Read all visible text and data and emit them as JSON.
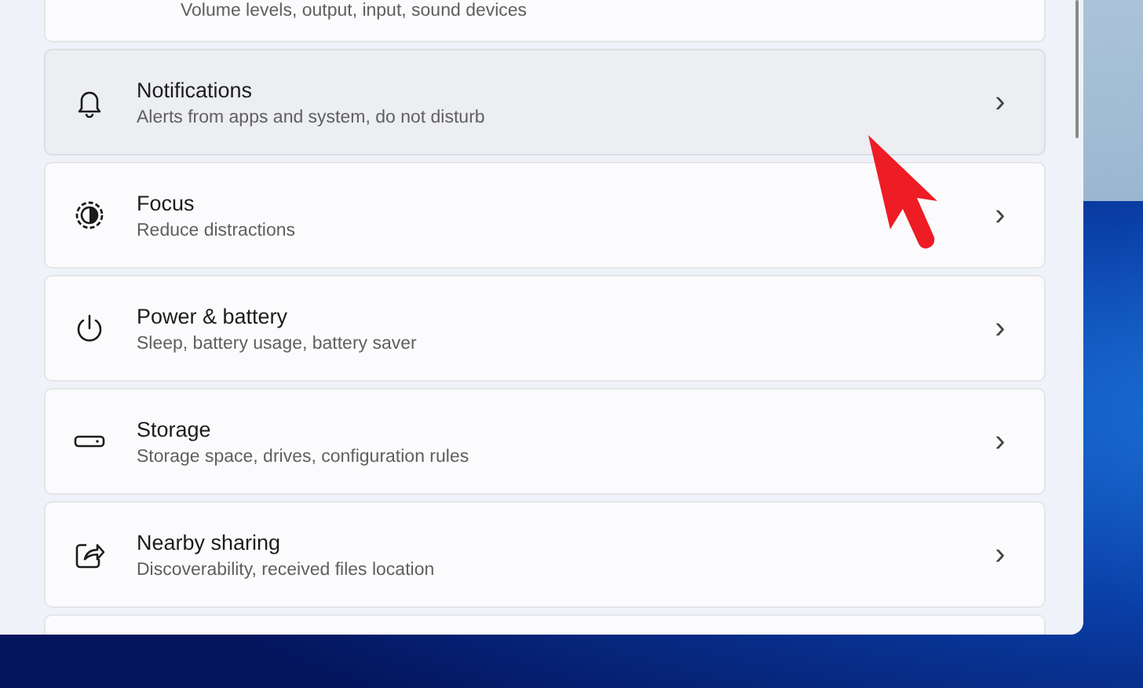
{
  "settings_list": {
    "partial_item": {
      "subtitle": "Volume levels, output, input, sound devices"
    },
    "items": [
      {
        "title": "Notifications",
        "subtitle": "Alerts from apps and system, do not disturb",
        "chevron": "›",
        "hovered": true
      },
      {
        "title": "Focus",
        "subtitle": "Reduce distractions",
        "chevron": "›",
        "hovered": false
      },
      {
        "title": "Power & battery",
        "subtitle": "Sleep, battery usage, battery saver",
        "chevron": "›",
        "hovered": false
      },
      {
        "title": "Storage",
        "subtitle": "Storage space, drives, configuration rules",
        "chevron": "›",
        "hovered": false
      },
      {
        "title": "Nearby sharing",
        "subtitle": "Discoverability, received files location",
        "chevron": "›",
        "hovered": false
      }
    ]
  }
}
